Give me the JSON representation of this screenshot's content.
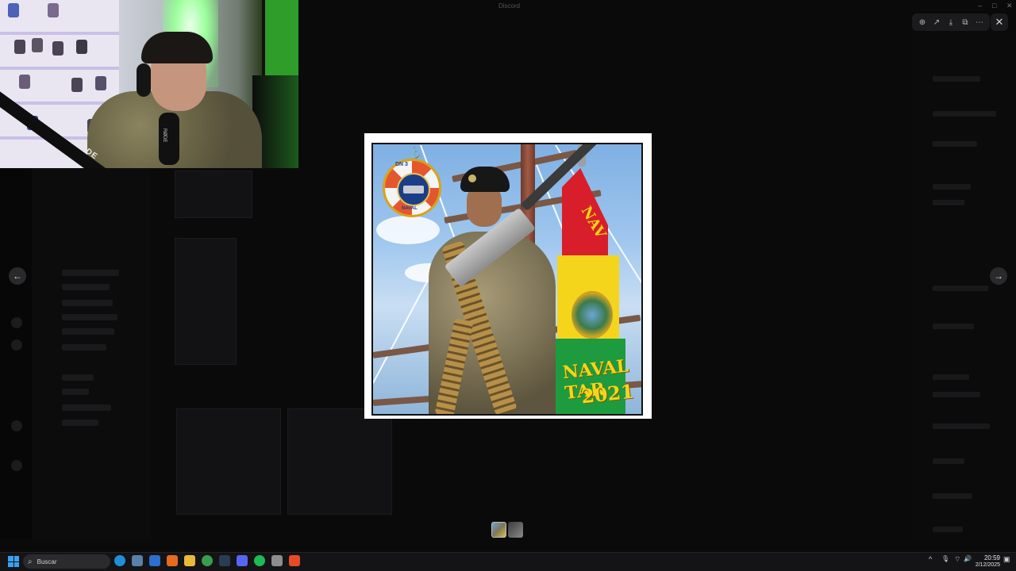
{
  "window": {
    "title": "Discord",
    "controls": {
      "minimize": "–",
      "maximize": "□",
      "close": "✕"
    }
  },
  "viewer": {
    "toolbar": [
      {
        "name": "zoom-icon",
        "glyph": "⊕"
      },
      {
        "name": "forward-icon",
        "glyph": "↗"
      },
      {
        "name": "download-icon",
        "glyph": "⤓"
      },
      {
        "name": "open-external-icon",
        "glyph": "⧉"
      },
      {
        "name": "more-icon",
        "glyph": "⋯"
      }
    ],
    "close_glyph": "✕",
    "prev_glyph": "←",
    "next_glyph": "→",
    "image": {
      "buoy_top": "DN 3",
      "buoy_bottom": "NAVAL",
      "flag_text_line1": "NAVAL TAR",
      "flag_text_line2": "2021",
      "flag_text_top": "NAV"
    }
  },
  "webcam": {
    "mic_brand": "RØDE",
    "mic_tag": "RØDE"
  },
  "taskbar": {
    "search_placeholder": "Buscar",
    "apps": [
      {
        "name": "edge-icon",
        "color": "#1f8fd8"
      },
      {
        "name": "files-icon",
        "color": "#5a7fa8"
      },
      {
        "name": "office-icon",
        "color": "#2b6fcf"
      },
      {
        "name": "arc-icon",
        "color": "#e56b1f"
      },
      {
        "name": "explorer-icon",
        "color": "#e9b93c"
      },
      {
        "name": "chrome-icon",
        "color": "#3a9c4f"
      },
      {
        "name": "steam-icon",
        "color": "#2a3b55"
      },
      {
        "name": "discord-icon",
        "color": "#5865f2"
      },
      {
        "name": "spotify-icon",
        "color": "#1db954"
      },
      {
        "name": "github-icon",
        "color": "#8d8d8d"
      },
      {
        "name": "brave-icon",
        "color": "#e84a27"
      }
    ],
    "tray": {
      "chevron": "^",
      "mic": "🎙",
      "wifi": "⌔",
      "volume": "🔊",
      "notification": "▣"
    },
    "time": "20:59",
    "date": "2/12/2025"
  }
}
